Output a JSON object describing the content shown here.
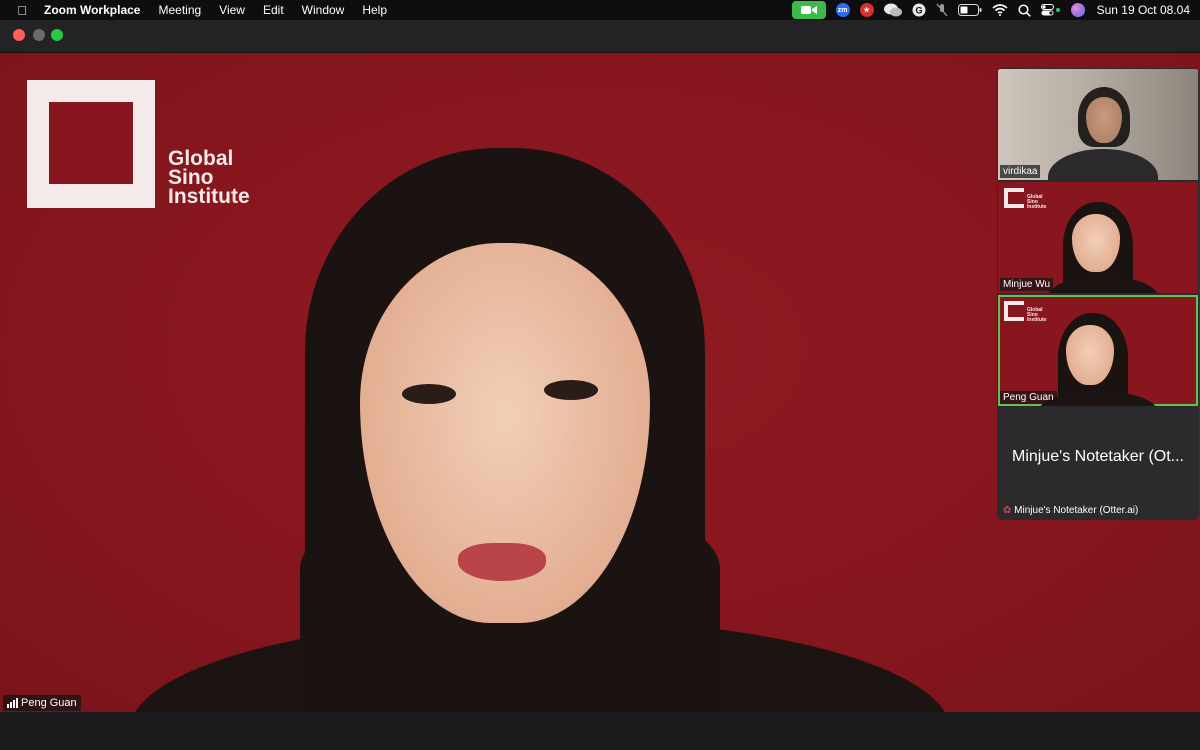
{
  "menubar": {
    "apple_icon": "apple-icon",
    "app_name": "Zoom Workplace",
    "items": [
      "Meeting",
      "View",
      "Edit",
      "Window",
      "Help"
    ],
    "status_icons": [
      "zoom-camera-icon",
      "zoom-icon",
      "record-icon",
      "wechat-icon",
      "grammarly-icon",
      "mute-mic-icon",
      "battery-icon",
      "wifi-icon",
      "search-icon",
      "control-center-icon",
      "siri-icon"
    ],
    "clock": "Sun 19 Oct  08.04"
  },
  "window": {
    "traffic_lights": {
      "close": "#ff5f57",
      "minimize": "#6b6b6b",
      "maximize": "#28c840"
    }
  },
  "main_video": {
    "background_lines": [
      "Global",
      "Sino",
      "Institute"
    ],
    "speaker_name": "Peng Guan",
    "background_color": "#87161e"
  },
  "gallery": {
    "tiles": [
      {
        "name": "virdikaa",
        "type": "video"
      },
      {
        "name": "Minjue Wu",
        "type": "video",
        "background_lines": [
          "Global",
          "Sino",
          "Institute"
        ]
      },
      {
        "name": "Peng Guan",
        "type": "video",
        "active": true,
        "background_lines": [
          "Global",
          "Sino",
          "Institute"
        ]
      },
      {
        "name": "Minjue's Notetaker (Otter.ai)",
        "display_name": "Minjue's Notetaker (Ot...",
        "type": "avatar",
        "muted": true
      }
    ],
    "active_color": "#5ec44f"
  }
}
